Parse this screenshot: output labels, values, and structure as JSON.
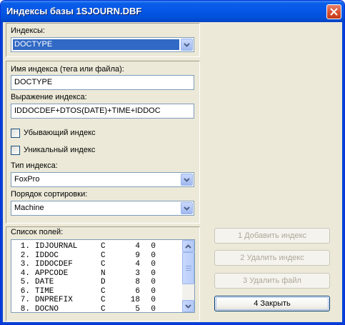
{
  "window": {
    "title": "Индексы базы 1SJOURN.DBF"
  },
  "indexes": {
    "label": "Индексы:",
    "selected": "DOCTYPE"
  },
  "index_name": {
    "label": "Имя индекса (тега или файла):",
    "value": "DOCTYPE"
  },
  "index_expr": {
    "label": "Выражение индекса:",
    "value": "IDDOCDEF+DTOS(DATE)+TIME+IDDOC"
  },
  "descending": {
    "label": "Убывающий индекс",
    "checked": false
  },
  "unique": {
    "label": "Уникальный индекс",
    "checked": false
  },
  "index_type": {
    "label": "Тип индекса:",
    "selected": "FoxPro"
  },
  "sort_order": {
    "label": "Порядок сортировки:",
    "selected": "Machine"
  },
  "fields": {
    "label": "Список полей:",
    "rows": [
      {
        "num": "1.",
        "name": "IDJOURNAL",
        "type": "C",
        "len": "4",
        "dec": "0"
      },
      {
        "num": "2.",
        "name": "IDDOC",
        "type": "C",
        "len": "9",
        "dec": "0"
      },
      {
        "num": "3.",
        "name": "IDDOCDEF",
        "type": "C",
        "len": "4",
        "dec": "0"
      },
      {
        "num": "4.",
        "name": "APPCODE",
        "type": "N",
        "len": "3",
        "dec": "0"
      },
      {
        "num": "5.",
        "name": "DATE",
        "type": "D",
        "len": "8",
        "dec": "0"
      },
      {
        "num": "6.",
        "name": "TIME",
        "type": "C",
        "len": "6",
        "dec": "0"
      },
      {
        "num": "7.",
        "name": "DNPREFIX",
        "type": "C",
        "len": "18",
        "dec": "0"
      },
      {
        "num": "8.",
        "name": "DOCNO",
        "type": "C",
        "len": "5",
        "dec": "0"
      }
    ]
  },
  "buttons": {
    "add_index": "1 Добавить индекс",
    "delete_index": "2 Удалить индекс",
    "delete_file": "3 Удалить файл",
    "close": "4 Закрыть"
  },
  "icons": {
    "close": "close-icon",
    "dropdown": "chevron-down-icon",
    "scroll_up": "chevron-up-icon",
    "scroll_down": "chevron-down-icon"
  },
  "colors": {
    "titlebar": "#0656e6",
    "selection": "#316ac5",
    "dialog": "#ece9d8"
  }
}
